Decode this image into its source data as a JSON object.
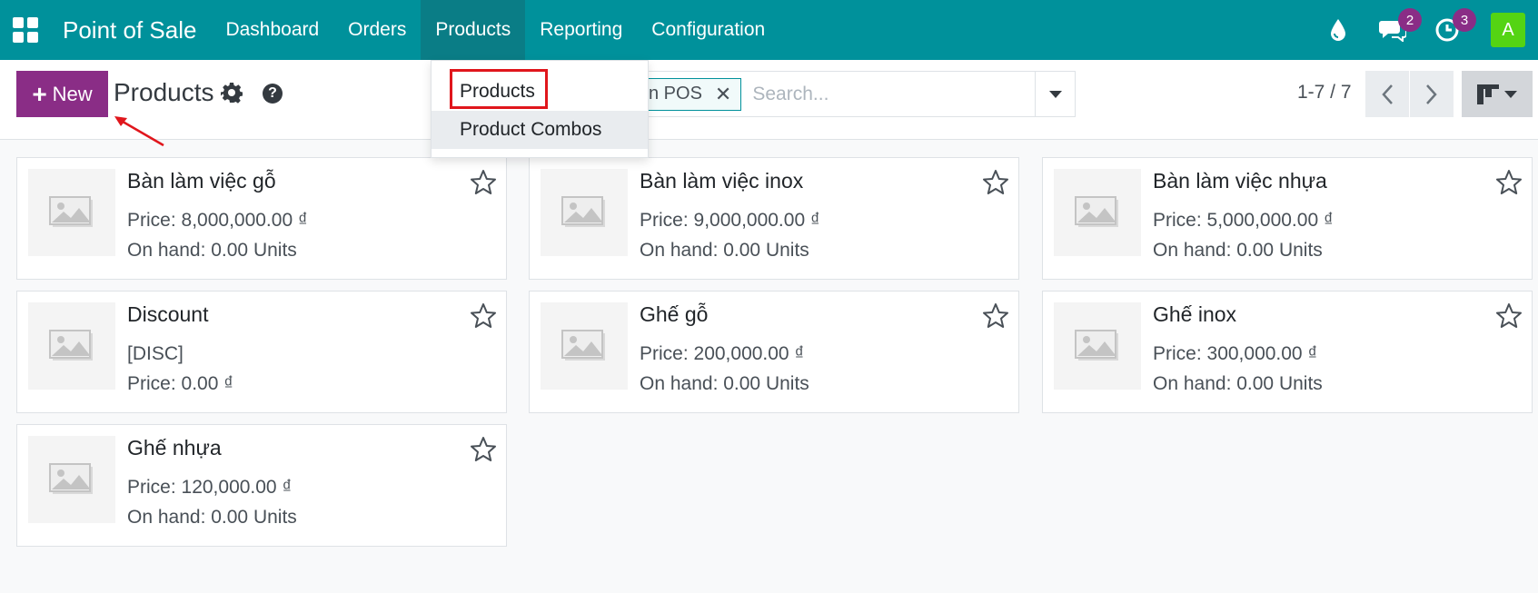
{
  "navbar": {
    "brand": "Point of Sale",
    "menu": [
      "Dashboard",
      "Orders",
      "Products",
      "Reporting",
      "Configuration"
    ],
    "active_menu": "Products",
    "messages_badge": "2",
    "activities_badge": "3",
    "avatar_letter": "A",
    "bg_color": "#00919b"
  },
  "control": {
    "new_label": "New",
    "title": "Products",
    "facet_label": "n POS",
    "search_placeholder": "Search...",
    "pager": "1-7 / 7"
  },
  "dropdown": {
    "items": [
      "Products",
      "Product Combos"
    ],
    "highlighted": "Products"
  },
  "products": [
    {
      "name": "Bàn làm việc gỗ",
      "line1": "Price: 8,000,000.00 ₫",
      "line2": "On hand: 0.00 Units"
    },
    {
      "name": "Bàn làm việc inox",
      "line1": "Price: 9,000,000.00 ₫",
      "line2": "On hand: 0.00 Units"
    },
    {
      "name": "Bàn làm việc nhựa",
      "line1": "Price: 5,000,000.00 ₫",
      "line2": "On hand: 0.00 Units"
    },
    {
      "name": "Discount",
      "line1": "[DISC]",
      "line2": "Price: 0.00 ₫"
    },
    {
      "name": "Ghế gỗ",
      "line1": "Price: 200,000.00 ₫",
      "line2": "On hand: 0.00 Units"
    },
    {
      "name": "Ghế inox",
      "line1": "Price: 300,000.00 ₫",
      "line2": "On hand: 0.00 Units"
    },
    {
      "name": "Ghế nhựa",
      "line1": "Price: 120,000.00 ₫",
      "line2": "On hand: 0.00 Units"
    }
  ],
  "icons": {
    "apps": "apps-grid-icon",
    "drop": "droplet-icon",
    "messages": "chat-icon",
    "activities": "clock-icon",
    "settings": "gear-icon",
    "help": "question-icon",
    "prev": "chevron-left-icon",
    "next": "chevron-right-icon",
    "view": "kanban-icon",
    "favorite": "star-icon"
  }
}
